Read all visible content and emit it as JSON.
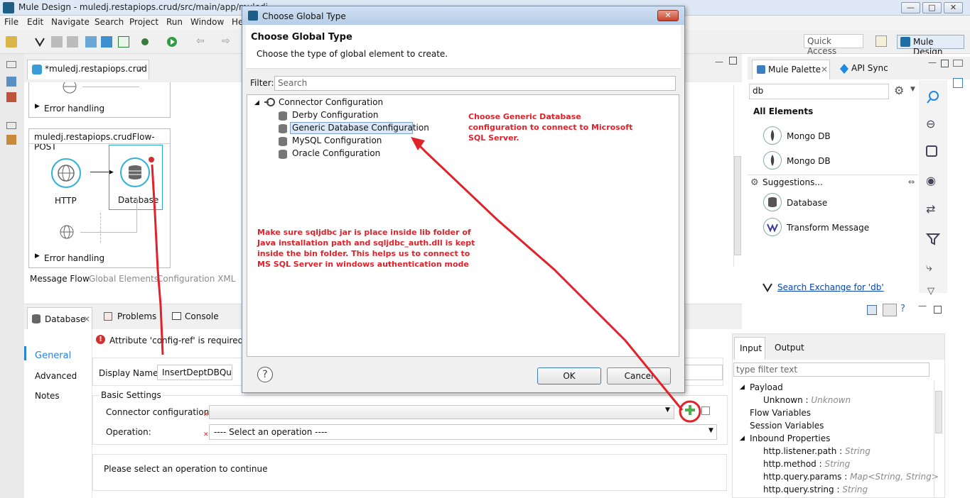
{
  "window": {
    "title": "Mule Design - muledj.restapiops.crud/src/main/app/muledj",
    "controls": [
      "—",
      "□",
      "✕"
    ]
  },
  "menu": [
    "File",
    "Edit",
    "Navigate",
    "Search",
    "Project",
    "Run",
    "Window",
    "He"
  ],
  "toolbar": {
    "quick_access_placeholder": "Quick Access",
    "perspective_label": "Mule Design"
  },
  "editor": {
    "tab_label": "*muledj.restapiops.crud",
    "error_handling_1": "Error handling",
    "flow_name": "muledj.restapiops.crudFlow-POST",
    "http_label": "HTTP",
    "database_label": "Database",
    "error_handling_2": "Error handling",
    "view_tabs": [
      "Message Flow",
      "Global Elements",
      "Configuration XML"
    ]
  },
  "palette": {
    "tabs": [
      "Mule Palette",
      "API Sync"
    ],
    "search_value": "db",
    "all_elements_heading": "All Elements",
    "all_elements": [
      "Mongo DB",
      "Mongo DB"
    ],
    "suggestions_heading": "Suggestions...",
    "suggestions": [
      "Database",
      "Transform Message"
    ],
    "exchange_link": "Search Exchange for 'db'"
  },
  "bottom": {
    "tabs": [
      "Database",
      "Problems",
      "Console"
    ],
    "error_message": "Attribute 'config-ref' is required",
    "nav": [
      "General",
      "Advanced",
      "Notes"
    ],
    "display_name_label": "Display Name:",
    "display_name_value": "InsertDeptDBQuery",
    "basic_settings_label": "Basic Settings",
    "connector_config_label": "Connector configuration:",
    "connector_config_value": "",
    "operation_label": "Operation:",
    "operation_value": "---- Select an operation ----",
    "info_message": "Please select an operation to continue"
  },
  "metadata": {
    "tabs": [
      "Input",
      "Output"
    ],
    "filter_placeholder": "type filter text",
    "tree": [
      {
        "label": "Payload",
        "type": ""
      },
      {
        "label": "Unknown : ",
        "type": "Unknown"
      },
      {
        "label": "Flow Variables",
        "type": ""
      },
      {
        "label": "Session Variables",
        "type": ""
      },
      {
        "label": "Inbound Properties",
        "type": ""
      },
      {
        "label": "http.listener.path : ",
        "type": "String"
      },
      {
        "label": "http.method : ",
        "type": "String"
      },
      {
        "label": "http.query.params : ",
        "type": "Map<String, String>"
      },
      {
        "label": "http.query.string : ",
        "type": "String"
      }
    ]
  },
  "dialog": {
    "title": "Choose Global Type",
    "heading": "Choose Global Type",
    "description": "Choose the type of global element to create.",
    "filter_label": "Filter:",
    "filter_placeholder": "Search",
    "tree_root": "Connector Configuration",
    "tree_children": [
      "Derby Configuration",
      "Generic Database Configuration",
      "MySQL Configuration",
      "Oracle Configuration"
    ],
    "ok_label": "OK",
    "cancel_label": "Cancel",
    "help_symbol": "?"
  },
  "annotations": {
    "note_generic": "Choose Generic Database configuration to connect to Microsoft SQL Server.",
    "note_jar": "Make sure sqljdbc jar is place inside lib folder of Java installation path and sqljdbc_auth.dll is kept inside the bin folder. This helps us to connect to MS SQL Server in windows authentication mode",
    "arrow_color": "#e0222a"
  }
}
